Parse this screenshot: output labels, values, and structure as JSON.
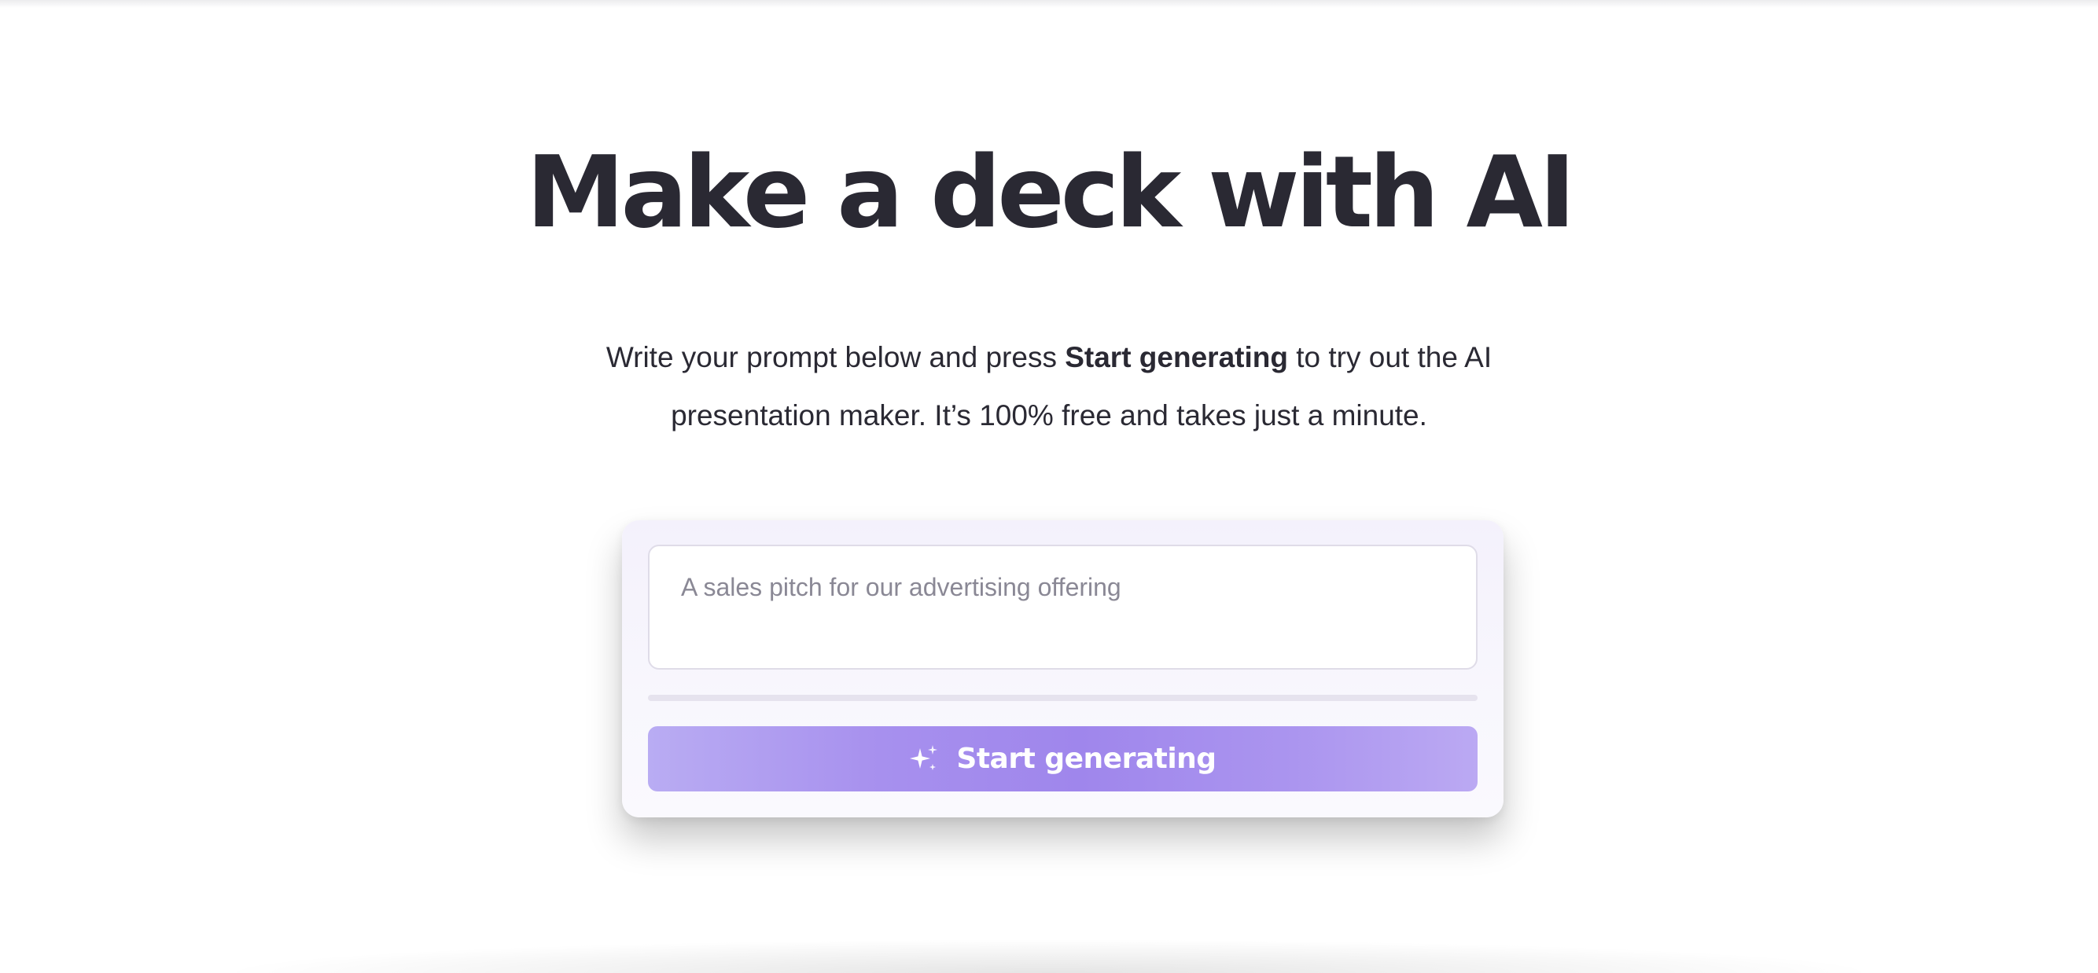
{
  "hero": {
    "title": "Make a deck with AI"
  },
  "intro": {
    "text_before": "Write your prompt below and press ",
    "bold_text": "Start generating",
    "text_after": " to try out the AI presentation maker. It’s 100% free and takes just a minute."
  },
  "prompt": {
    "value": "",
    "placeholder": "A sales pitch for our advertising offering"
  },
  "generate": {
    "label": "Start generating",
    "icon": "sparkle-icon"
  },
  "colors": {
    "text_dark": "#2a2933",
    "button_purple": "#9f86ec",
    "card_background": "#f6f4fd"
  }
}
